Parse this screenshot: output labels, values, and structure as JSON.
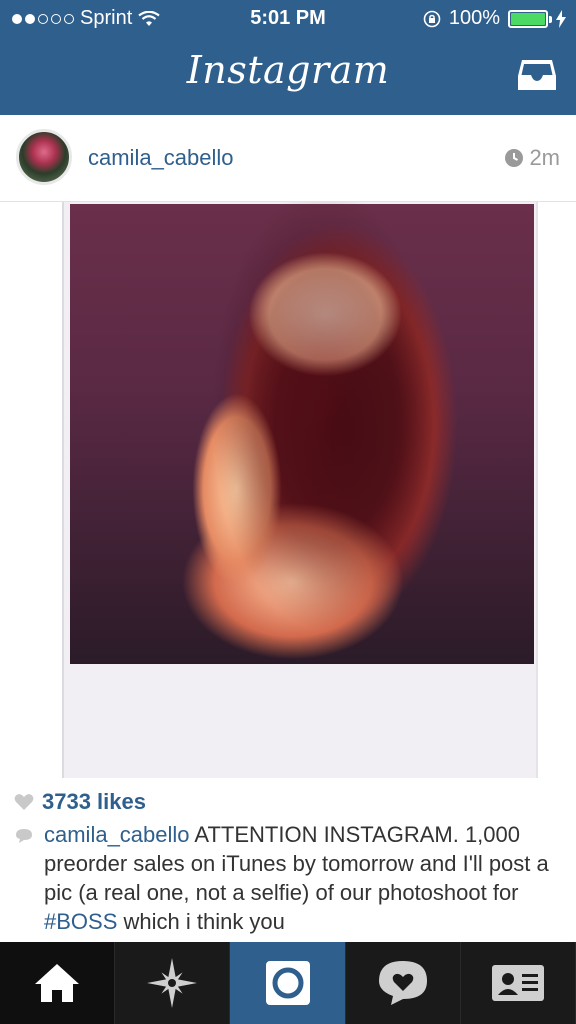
{
  "status_bar": {
    "carrier": "Sprint",
    "time": "5:01 PM",
    "battery": "100%",
    "signal_dots_filled": 2,
    "signal_dots_total": 5
  },
  "nav": {
    "title": "Instagram",
    "inbox_icon": "inbox-tray-icon"
  },
  "post": {
    "username": "camila_cabello",
    "time_ago": "2m",
    "likes": "3733 likes",
    "caption": {
      "user": "camila_cabello",
      "text_before": " ATTENTION INSTAGRAM. 1,000 preorder sales on iTunes by tomorrow and I'll post a pic (a real one, not a selfie) of our photoshoot for ",
      "hashtag": "#BOSS",
      "text_after": " which i think you"
    }
  },
  "tabs": [
    {
      "name": "home",
      "icon": "home-icon"
    },
    {
      "name": "explore",
      "icon": "compass-star-icon"
    },
    {
      "name": "camera",
      "icon": "camera-icon"
    },
    {
      "name": "activity",
      "icon": "heart-bubble-icon"
    },
    {
      "name": "profile",
      "icon": "profile-card-icon"
    }
  ],
  "colors": {
    "accent": "#2f5f8d",
    "tabbar": "#1a1a1a",
    "battery": "#4cd964"
  }
}
